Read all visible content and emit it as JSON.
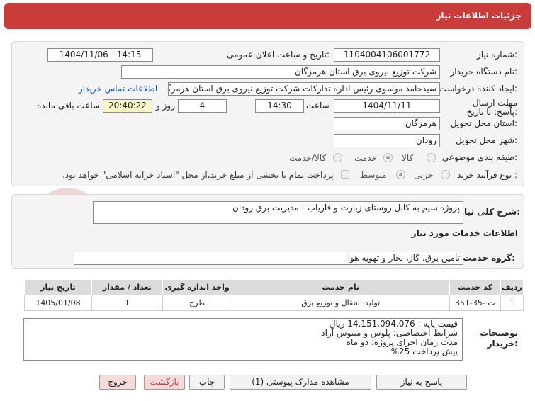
{
  "header": {
    "title": "جزئیات اطلاعات نیاز"
  },
  "form": {
    "need_number_label": "شماره نیاز:",
    "need_number": "1104004106001772",
    "announce_label": "تاریخ و ساعت اعلان عمومی:",
    "announce_value": "1404/11/06 - 14:15",
    "buyer_org_label": "نام دستگاه خریدار:",
    "buyer_org": "شرکت توزیع نیروی برق استان هرمزگان",
    "requester_label": "ایجاد کننده درخواست:",
    "requester": "سیدحامد موسوی رئیس اداره تدارکات شرکت توزیع نیروی برق استان هرمزگان",
    "contact_link": "اطلاعات تماس خریدار",
    "deadline_label": "مهلت ارسال پاسخ: تا تاریخ:",
    "deadline_date": "1404/11/11",
    "time_label": "ساعت",
    "deadline_time": "14:30",
    "days_value": "4",
    "days_label": "روز و",
    "remaining_time": "20:40:22",
    "remaining_label": "ساعت باقی مانده",
    "province_label": "استان محل تحویل:",
    "province": "هرمزگان",
    "city_label": "شهر محل تحویل:",
    "city": "رودان",
    "category_label": "طبقه بندی موضوعی:",
    "category_options": [
      "کالا",
      "خدمت",
      "کالا/خدمت"
    ],
    "category_selected": "خدمت",
    "process_label": "نوع فرآیند خرید :",
    "process_options": [
      "جزیی",
      "متوسط"
    ],
    "process_selected": "متوسط",
    "payment_note": "پرداخت تمام یا بخشی از مبلغ خرید،از محل \"اسناد خزانه اسلامی\" خواهد بود."
  },
  "description": {
    "label": "شرح کلی نیاز:",
    "value": "پروژه سیم به کابل روستای زیارت و فاریاب - مدیریت برق رودان"
  },
  "services": {
    "section_title": "اطلاعات خدمات مورد نیاز",
    "group_label": "گروه خدمت:",
    "group_value": "تامین برق، گاز، بخار و تهویه هوا",
    "columns": [
      "ردیف",
      "کد خدمت",
      "نام خدمت",
      "واحد اندازه گیری",
      "تعداد / مقدار",
      "تاریخ نیاز"
    ],
    "rows": [
      [
        "1",
        "ت -35-351",
        "تولید، انتقال و توزیع برق",
        "طرح",
        "1",
        "1405/01/08"
      ]
    ]
  },
  "buyer_notes": {
    "label": "توضیحات خریدار:",
    "lines": [
      "قیمت پایه : 14.151.094.076 ریال",
      "شرایط اختصاصی: پلوس و مینوس آزاد",
      "مدت زمان اجرای پروژه: دو ماه",
      "پیش پرداخت 25%"
    ]
  },
  "watermark": {
    "text": "AriaTender.neT"
  },
  "buttons": {
    "reply": "پاسخ به نیاز",
    "view_docs": "مشاهده مدارک پیوستی (1)",
    "print": "چاپ",
    "back": "بازگشت",
    "exit": "خروج"
  },
  "colors": {
    "header": "#c93c3a",
    "watermark": "#e3a6a6"
  }
}
